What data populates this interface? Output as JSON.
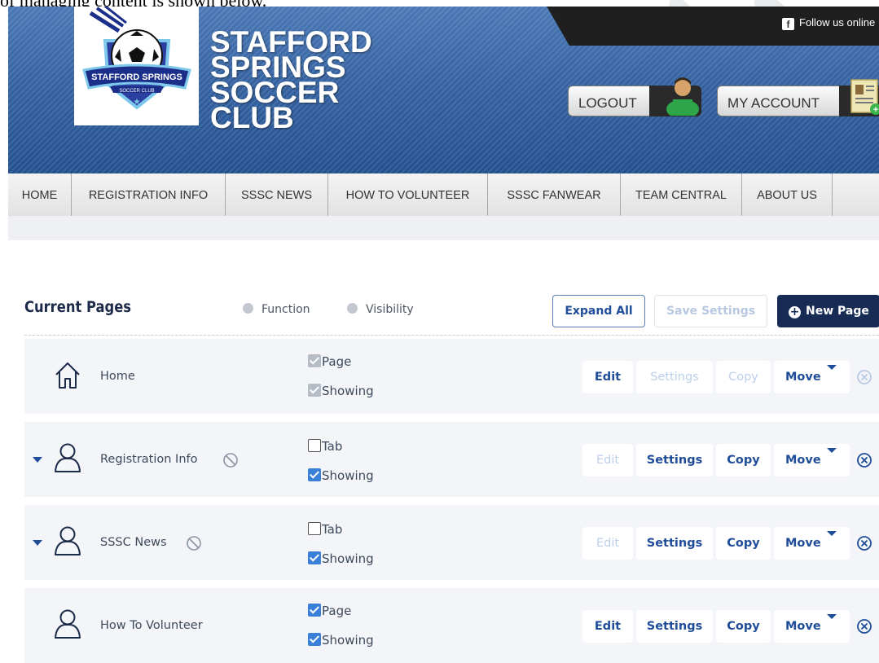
{
  "doc_snippet": "of managing content is shown below.",
  "header": {
    "follow_text": "Follow us online",
    "club_name": [
      "STAFFORD",
      "SPRINGS",
      "SOCCER",
      "CLUB"
    ],
    "logo_text_main": "STAFFORD SPRINGS",
    "logo_text_sub": "SOCCER CLUB",
    "logout_label": "LOGOUT",
    "my_account_label": "MY ACCOUNT"
  },
  "nav": [
    "HOME",
    "REGISTRATION INFO",
    "SSSC NEWS",
    "HOW TO VOLUNTEER",
    "SSSC FANWEAR",
    "TEAM CENTRAL",
    "ABOUT US"
  ],
  "toolbar": {
    "title": "Current Pages",
    "legend_function": "Function",
    "legend_visibility": "Visibility",
    "expand_all": "Expand All",
    "save_settings": "Save Settings",
    "new_page": "New Page"
  },
  "pages": [
    {
      "name": "Home",
      "icon": "home-icon",
      "expandable": false,
      "hidden_marker": false,
      "function_label": "Page",
      "function_state": "checked-disabled",
      "visibility_label": "Showing",
      "visibility_state": "checked-disabled",
      "edit": "Edit",
      "edit_enabled": true,
      "settings": "Settings",
      "settings_enabled": false,
      "copy": "Copy",
      "copy_enabled": false,
      "move": "Move",
      "remove_enabled": false
    },
    {
      "name": "Registration Info",
      "icon": "user-icon",
      "expandable": true,
      "hidden_marker": true,
      "function_label": "Tab",
      "function_state": "unchecked",
      "visibility_label": "Showing",
      "visibility_state": "checked",
      "edit": "Edit",
      "edit_enabled": false,
      "settings": "Settings",
      "settings_enabled": true,
      "copy": "Copy",
      "copy_enabled": true,
      "move": "Move",
      "remove_enabled": true
    },
    {
      "name": "SSSC News",
      "icon": "user-icon",
      "expandable": true,
      "hidden_marker": true,
      "function_label": "Tab",
      "function_state": "unchecked",
      "visibility_label": "Showing",
      "visibility_state": "checked",
      "edit": "Edit",
      "edit_enabled": false,
      "settings": "Settings",
      "settings_enabled": true,
      "copy": "Copy",
      "copy_enabled": true,
      "move": "Move",
      "remove_enabled": true
    },
    {
      "name": "How To Volunteer",
      "icon": "user-icon",
      "expandable": false,
      "hidden_marker": false,
      "function_label": "Page",
      "function_state": "checked",
      "visibility_label": "Showing",
      "visibility_state": "checked",
      "edit": "Edit",
      "edit_enabled": true,
      "settings": "Settings",
      "settings_enabled": true,
      "copy": "Copy",
      "copy_enabled": true,
      "move": "Move",
      "remove_enabled": true
    }
  ],
  "colors": {
    "brand_blue": "#3563a2",
    "primary": "#1f4d9a",
    "dark_button": "#182b55",
    "checkbox": "#3a7fd8"
  }
}
